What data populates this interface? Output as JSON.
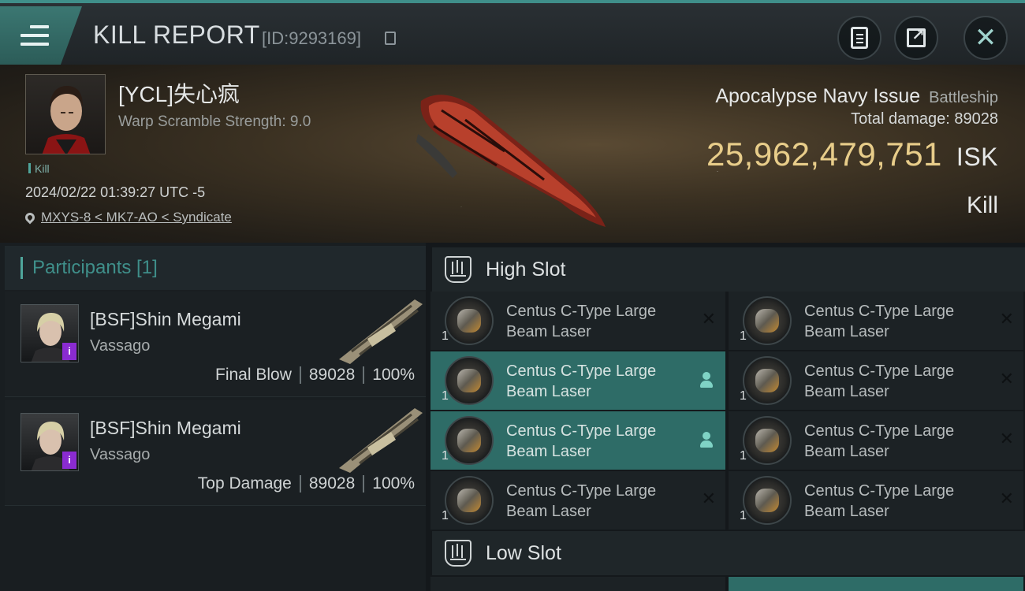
{
  "header": {
    "title": "KILL REPORT",
    "report_id": "[ID:9293169]",
    "icons": [
      "menu-icon",
      "copy-icon",
      "clipboard-icon",
      "share-icon",
      "close-icon"
    ]
  },
  "victim": {
    "name": "[YCL]失心疯",
    "warp_scramble": "Warp Scramble Strength: 9.0",
    "tag": "Kill",
    "datetime": "2024/02/22 01:39:27 UTC -5",
    "location": "MXYS-8 < MK7-AO < Syndicate",
    "ship_name": "Apocalypse Navy Issue",
    "ship_class": "Battleship",
    "total_damage_label": "Total damage:",
    "total_damage": "89028",
    "isk_value": "25,962,479,751",
    "isk_unit": "ISK",
    "outcome": "Kill"
  },
  "participants": {
    "header": "Participants [1]",
    "rows": [
      {
        "name": "[BSF]Shin Megami",
        "ship": "Vassago",
        "role": "Final Blow",
        "damage": "89028",
        "percent": "100%"
      },
      {
        "name": "[BSF]Shin Megami",
        "ship": "Vassago",
        "role": "Top Damage",
        "damage": "89028",
        "percent": "100%"
      }
    ]
  },
  "fitting": {
    "high_slot_label": "High Slot",
    "low_slot_label": "Low Slot",
    "modules": [
      {
        "line1": "Centus C-Type Large",
        "line2": "Beam Laser",
        "qty": "1",
        "state": "destroyed"
      },
      {
        "line1": "Centus C-Type Large",
        "line2": "Beam Laser",
        "qty": "1",
        "state": "destroyed"
      },
      {
        "line1": "Centus C-Type Large",
        "line2": "Beam Laser",
        "qty": "1",
        "state": "dropped"
      },
      {
        "line1": "Centus C-Type Large",
        "line2": "Beam Laser",
        "qty": "1",
        "state": "destroyed"
      },
      {
        "line1": "Centus C-Type Large",
        "line2": "Beam Laser",
        "qty": "1",
        "state": "dropped"
      },
      {
        "line1": "Centus C-Type Large",
        "line2": "Beam Laser",
        "qty": "1",
        "state": "destroyed"
      },
      {
        "line1": "Centus C-Type Large",
        "line2": "Beam Laser",
        "qty": "1",
        "state": "destroyed"
      },
      {
        "line1": "Centus C-Type Large",
        "line2": "Beam Laser",
        "qty": "1",
        "state": "destroyed"
      }
    ]
  },
  "colors": {
    "accent": "#3f8f8a",
    "isk": "#e8cd8a",
    "highlight": "#2e6c67",
    "badge": "#8a2bd0"
  }
}
